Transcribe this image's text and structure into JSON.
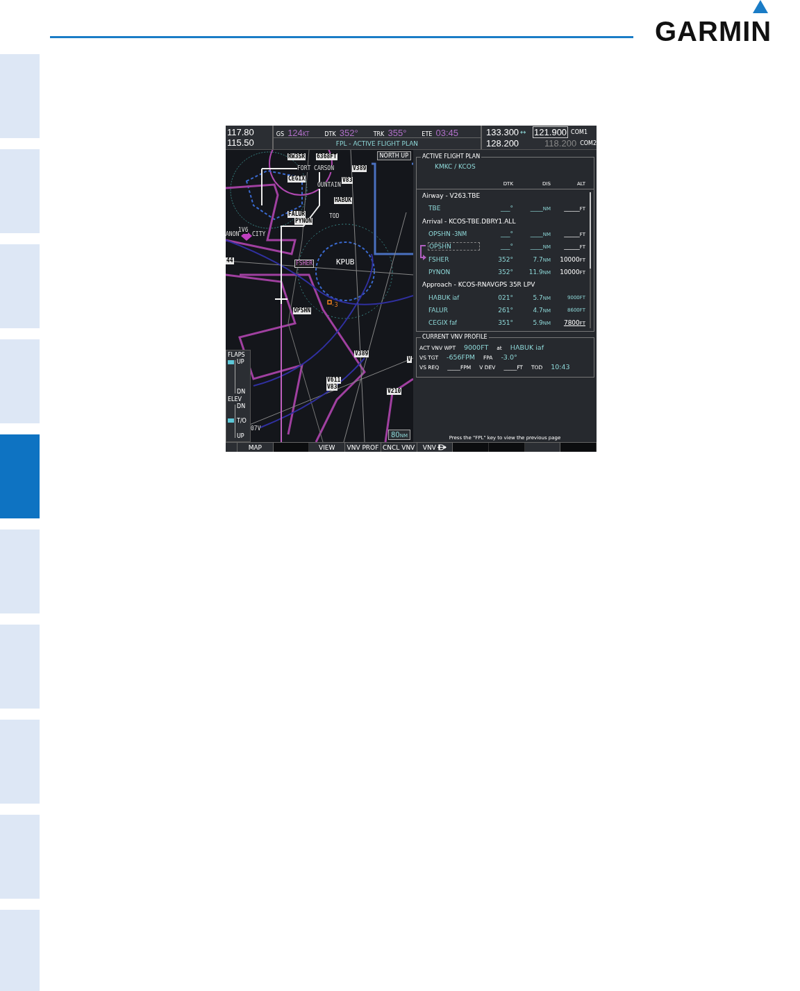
{
  "header": {
    "logo": "GARMIN"
  },
  "section_tabs": [
    {
      "selected": false
    },
    {
      "selected": false
    },
    {
      "selected": false
    },
    {
      "selected": false
    },
    {
      "selected": true
    },
    {
      "selected": false
    },
    {
      "selected": false
    },
    {
      "selected": false
    },
    {
      "selected": false
    },
    {
      "selected": false
    }
  ],
  "screen": {
    "nav": [
      "117.80",
      "115.50"
    ],
    "data_fields": [
      {
        "label": "GS",
        "value": "124",
        "unit": "KT"
      },
      {
        "label": "DTK",
        "value": "352°"
      },
      {
        "label": "TRK",
        "value": "355°"
      },
      {
        "label": "ETE",
        "value": "03:45"
      }
    ],
    "page_title": "FPL - ACTIVE FLIGHT PLAN",
    "com": [
      {
        "active": "133.300",
        "transfer": "↔",
        "standby": "121.900",
        "name": "COM1",
        "selected": true
      },
      {
        "active": "128.200",
        "standby": "118.200",
        "name": "COM2",
        "selected": false
      }
    ],
    "map": {
      "orientation": "NORTH UP",
      "range": {
        "value": "80",
        "unit": "NM"
      },
      "labels": [
        {
          "text": "RW35R",
          "kind": "box"
        },
        {
          "text": "6368FT",
          "kind": "box"
        },
        {
          "text": "FORT CARSON",
          "kind": "plain"
        },
        {
          "text": "V389",
          "kind": "box"
        },
        {
          "text": "CEGIX",
          "kind": "box"
        },
        {
          "text": "V83",
          "kind": "box"
        },
        {
          "text": "OUNTAIN",
          "kind": "plain"
        },
        {
          "text": "HABUK",
          "kind": "box"
        },
        {
          "text": "FALUR",
          "kind": "box"
        },
        {
          "text": "PYNON",
          "kind": "box"
        },
        {
          "text": "TOD",
          "kind": "plain"
        },
        {
          "text": "1V6",
          "kind": "plain"
        },
        {
          "text": "ANON",
          "kind": "plain"
        },
        {
          "text": "CITY",
          "kind": "plain"
        },
        {
          "text": "44",
          "kind": "box"
        },
        {
          "text": "FSHER",
          "kind": "active"
        },
        {
          "text": "KPUB",
          "kind": "airport"
        },
        {
          "text": "-3",
          "kind": "marker"
        },
        {
          "text": "OPSHN",
          "kind": "box"
        },
        {
          "text": "V389",
          "kind": "box"
        },
        {
          "text": "V",
          "kind": "box"
        },
        {
          "text": "V611",
          "kind": "box"
        },
        {
          "text": "V83",
          "kind": "box"
        },
        {
          "text": "V210",
          "kind": "box"
        },
        {
          "text": "07V",
          "kind": "plain"
        }
      ],
      "flaps": {
        "title": "FLAPS",
        "top": "UP",
        "bottom": "DN",
        "level": 1
      },
      "elev": {
        "title": "ELEV",
        "top": "DN",
        "middle": "T/O",
        "bottom": "UP",
        "level": 0.5
      }
    },
    "flight_plan": {
      "title": "ACTIVE FLIGHT PLAN",
      "route": "KMKC / KCOS",
      "columns": [
        "DTK",
        "DIS",
        "ALT"
      ],
      "rows": [
        {
          "kind": "header",
          "text": "Airway - V263.TBE"
        },
        {
          "kind": "waypoint",
          "name": "TBE",
          "dtk": "___°",
          "dis": "____",
          "dis_unit": "NM",
          "alt": "_____",
          "alt_unit": "FT",
          "estimated": false,
          "constraint": false,
          "selected": false,
          "active": false
        },
        {
          "kind": "header",
          "text": "Arrival - KCOS-TBE.DBRY1.ALL"
        },
        {
          "kind": "waypoint",
          "name": "OPSHN",
          "suffix": "-3NM",
          "dtk": "___°",
          "dis": "____",
          "dis_unit": "NM",
          "alt": "_____",
          "alt_unit": "FT",
          "estimated": false,
          "constraint": false,
          "selected": false,
          "active": false
        },
        {
          "kind": "waypoint",
          "name": "OPSHN",
          "dtk": "___°",
          "dis": "____",
          "dis_unit": "NM",
          "alt": "_____",
          "alt_unit": "FT",
          "estimated": false,
          "constraint": false,
          "selected": true,
          "active": false
        },
        {
          "kind": "waypoint",
          "name": "FSHER",
          "dtk": "352°",
          "dis": "7.7",
          "dis_unit": "NM",
          "alt": "10000",
          "alt_unit": "FT",
          "estimated": false,
          "constraint": false,
          "selected": false,
          "active": true
        },
        {
          "kind": "waypoint",
          "name": "PYNON",
          "dtk": "352°",
          "dis": "11.9",
          "dis_unit": "NM",
          "alt": "10000",
          "alt_unit": "FT",
          "estimated": false,
          "constraint": false,
          "selected": false,
          "active": false
        },
        {
          "kind": "header",
          "text": "Approach - KCOS-RNAVGPS 35R LPV"
        },
        {
          "kind": "waypoint",
          "name": "HABUK",
          "suffix": "iaf",
          "dtk": "021°",
          "dis": "5.7",
          "dis_unit": "NM",
          "alt": "9000",
          "alt_unit": "FT",
          "estimated": true,
          "constraint": false,
          "selected": false,
          "active": false
        },
        {
          "kind": "waypoint",
          "name": "FALUR",
          "dtk": "261°",
          "dis": "4.7",
          "dis_unit": "NM",
          "alt": "8600",
          "alt_unit": "FT",
          "estimated": true,
          "constraint": false,
          "selected": false,
          "active": false
        },
        {
          "kind": "waypoint",
          "name": "CEGIX",
          "suffix": "faf",
          "dtk": "351°",
          "dis": "5.9",
          "dis_unit": "NM",
          "alt": "7800",
          "alt_unit": "FT",
          "estimated": false,
          "constraint": true,
          "selected": false,
          "active": false
        }
      ]
    },
    "vnv_profile": {
      "title": "CURRENT VNV PROFILE",
      "rows": [
        [
          {
            "text": "ACT VNV WPT",
            "kind": "label"
          },
          {
            "text": "9000FT",
            "kind": "value"
          },
          {
            "text": "at",
            "kind": "label"
          },
          {
            "text": "HABUK iaf",
            "kind": "value"
          }
        ],
        [
          {
            "text": "VS TGT",
            "kind": "label"
          },
          {
            "text": "-656FPM",
            "kind": "value"
          },
          {
            "text": "FPA",
            "kind": "label"
          },
          {
            "text": "-3.0°",
            "kind": "value"
          }
        ],
        [
          {
            "text": "VS REQ",
            "kind": "label"
          },
          {
            "text": "_____FPM",
            "kind": "label"
          },
          {
            "text": "V DEV",
            "kind": "label"
          },
          {
            "text": "_____FT",
            "kind": "label"
          },
          {
            "text": "TOD",
            "kind": "label"
          },
          {
            "text": "10:43",
            "kind": "value"
          }
        ]
      ]
    },
    "footer_hint": "Press the \"FPL\" key to view the previous page",
    "softkeys": [
      {
        "kind": "partial",
        "disabled": false
      },
      {
        "label": "MAP",
        "disabled": false
      },
      {
        "disabled": true
      },
      {
        "label": "VIEW",
        "disabled": false
      },
      {
        "label": "VNV PROF",
        "disabled": false
      },
      {
        "label": "CNCL VNV",
        "disabled": false
      },
      {
        "label": "VNV",
        "kind": "direct",
        "disabled": false
      },
      {
        "disabled": true
      },
      {
        "disabled": true
      },
      {
        "disabled": false
      },
      {
        "disabled": true
      }
    ]
  }
}
